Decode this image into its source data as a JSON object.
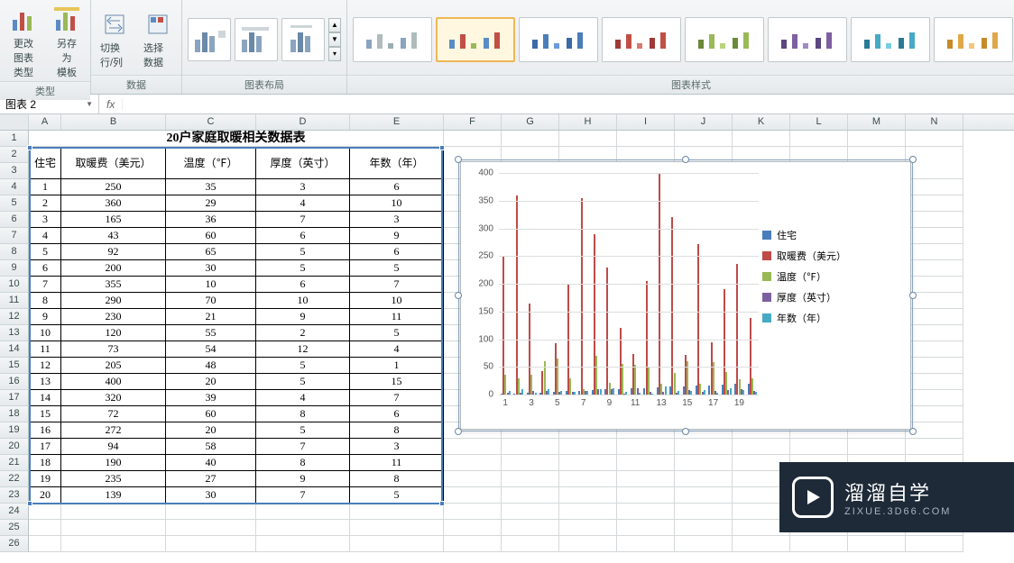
{
  "ribbon": {
    "groups": {
      "type": {
        "title": "类型",
        "change_chart": "更改\n图表类型",
        "save_template": "另存为\n模板"
      },
      "data": {
        "title": "数据",
        "switch_rc": "切换行/列",
        "select_data": "选择数据"
      },
      "layout": {
        "title": "图表布局"
      },
      "styles": {
        "title": "图表样式"
      }
    }
  },
  "namebox": "图表 2",
  "fx_label": "fx",
  "table": {
    "title": "20户家庭取暖相关数据表",
    "headers": [
      "住宅",
      "取暖费（美元）",
      "温度（℉）",
      "厚度（英寸）",
      "年数（年）"
    ],
    "rows": [
      [
        1,
        250,
        35,
        3,
        6
      ],
      [
        2,
        360,
        29,
        4,
        10
      ],
      [
        3,
        165,
        36,
        7,
        3
      ],
      [
        4,
        43,
        60,
        6,
        9
      ],
      [
        5,
        92,
        65,
        5,
        6
      ],
      [
        6,
        200,
        30,
        5,
        5
      ],
      [
        7,
        355,
        10,
        6,
        7
      ],
      [
        8,
        290,
        70,
        10,
        10
      ],
      [
        9,
        230,
        21,
        9,
        11
      ],
      [
        10,
        120,
        55,
        2,
        5
      ],
      [
        11,
        73,
        54,
        12,
        4
      ],
      [
        12,
        205,
        48,
        5,
        1
      ],
      [
        13,
        400,
        20,
        5,
        15
      ],
      [
        14,
        320,
        39,
        4,
        7
      ],
      [
        15,
        72,
        60,
        8,
        6
      ],
      [
        16,
        272,
        20,
        5,
        8
      ],
      [
        17,
        94,
        58,
        7,
        3
      ],
      [
        18,
        190,
        40,
        8,
        11
      ],
      [
        19,
        235,
        27,
        9,
        8
      ],
      [
        20,
        139,
        30,
        7,
        5
      ]
    ]
  },
  "columns": [
    "A",
    "B",
    "C",
    "D",
    "E",
    "F",
    "G",
    "H",
    "I",
    "J",
    "K",
    "L",
    "M",
    "N"
  ],
  "chart_data": {
    "type": "bar",
    "title": "",
    "xlabel": "",
    "ylabel": "",
    "ylim": [
      0,
      400
    ],
    "ytick_step": 50,
    "x_ticks": [
      1,
      3,
      5,
      7,
      9,
      11,
      13,
      15,
      17,
      19
    ],
    "series": [
      {
        "name": "住宅",
        "color": "#4a7ebb",
        "values": [
          1,
          2,
          3,
          4,
          5,
          6,
          7,
          8,
          9,
          10,
          11,
          12,
          13,
          14,
          15,
          16,
          17,
          18,
          19,
          20
        ]
      },
      {
        "name": "取暖费（美元）",
        "color": "#be4b48",
        "values": [
          250,
          360,
          165,
          43,
          92,
          200,
          355,
          290,
          230,
          120,
          73,
          205,
          400,
          320,
          72,
          272,
          94,
          190,
          235,
          139
        ]
      },
      {
        "name": "温度（℉）",
        "color": "#98b954",
        "values": [
          35,
          29,
          36,
          60,
          65,
          30,
          10,
          70,
          21,
          55,
          54,
          48,
          20,
          39,
          60,
          20,
          58,
          40,
          27,
          30
        ]
      },
      {
        "name": "厚度（英寸）",
        "color": "#7d60a0",
        "values": [
          3,
          4,
          7,
          6,
          5,
          5,
          6,
          10,
          9,
          2,
          12,
          5,
          5,
          4,
          8,
          5,
          7,
          8,
          9,
          7
        ]
      },
      {
        "name": "年数（年）",
        "color": "#46aac5",
        "values": [
          6,
          10,
          3,
          9,
          6,
          5,
          7,
          10,
          11,
          5,
          4,
          1,
          15,
          7,
          6,
          8,
          3,
          11,
          8,
          5
        ]
      }
    ]
  },
  "watermark": {
    "brand": "溜溜自学",
    "url": "ZIXUE.3D66.COM"
  }
}
